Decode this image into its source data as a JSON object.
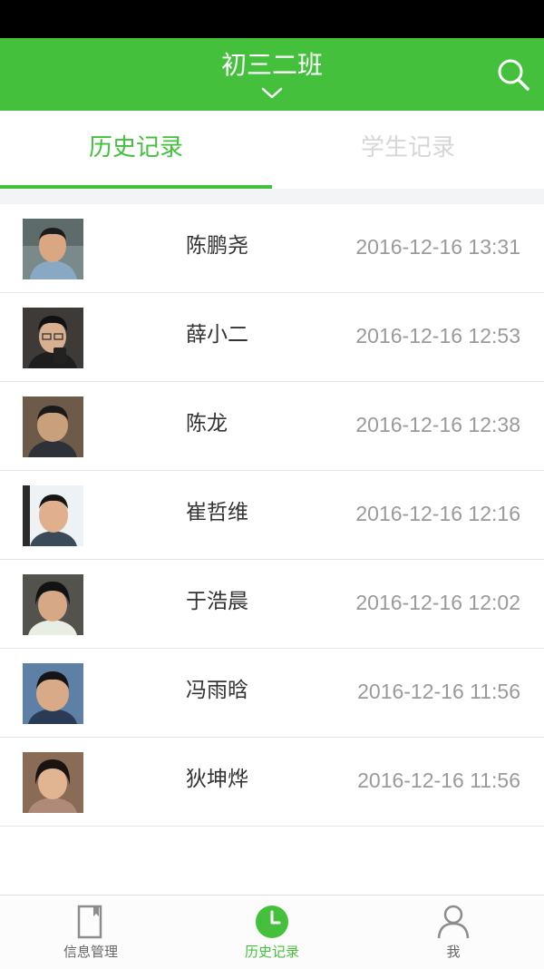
{
  "header": {
    "title": "初三二班"
  },
  "tabs": [
    {
      "label": "历史记录",
      "active": true
    },
    {
      "label": "学生记录",
      "active": false
    }
  ],
  "records": [
    {
      "name": "陈鹏尧",
      "time": "2016-12-16 13:31"
    },
    {
      "name": "薛小二",
      "time": "2016-12-16 12:53"
    },
    {
      "name": "陈龙",
      "time": "2016-12-16 12:38"
    },
    {
      "name": "崔哲维",
      "time": "2016-12-16 12:16"
    },
    {
      "name": "于浩晨",
      "time": "2016-12-16 12:02"
    },
    {
      "name": "冯雨晗",
      "time": "2016-12-16 11:56"
    },
    {
      "name": "狄坤烨",
      "time": "2016-12-16 11:56"
    }
  ],
  "bottom_nav": [
    {
      "label": "信息管理",
      "icon": "document-icon",
      "active": false
    },
    {
      "label": "历史记录",
      "icon": "clock-icon",
      "active": true
    },
    {
      "label": "我",
      "icon": "person-icon",
      "active": false
    }
  ],
  "colors": {
    "brand": "#44c03d",
    "status_bar": "#000000",
    "inactive_tab": "#d6d6d6",
    "time_text": "#9a9a9a"
  }
}
